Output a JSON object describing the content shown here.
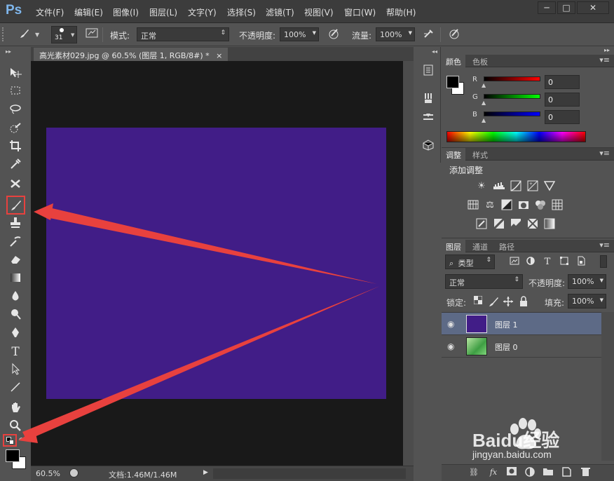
{
  "app": {
    "logo": "Ps"
  },
  "menu": [
    "文件(F)",
    "编辑(E)",
    "图像(I)",
    "图层(L)",
    "文字(Y)",
    "选择(S)",
    "滤镜(T)",
    "视图(V)",
    "窗口(W)",
    "帮助(H)"
  ],
  "window_buttons": {
    "minimize": "─",
    "maximize": "□",
    "close": "✕"
  },
  "options": {
    "brush_size": "31",
    "mode_label": "模式:",
    "mode_value": "正常",
    "opacity_label": "不透明度:",
    "opacity_value": "100%",
    "flow_label": "流量:",
    "flow_value": "100%"
  },
  "document": {
    "tab_title": "高光素材029.jpg @ 60.5% (图层 1, RGB/8#) *",
    "close": "×",
    "canvas_color": "#411d87"
  },
  "status": {
    "zoom": "60.5%",
    "doc_info": "文档:1.46M/1.46M"
  },
  "color_panel": {
    "tabs": [
      "颜色",
      "色板"
    ],
    "channels": [
      {
        "label": "R",
        "value": "0"
      },
      {
        "label": "G",
        "value": "0"
      },
      {
        "label": "B",
        "value": "0"
      }
    ]
  },
  "adjust_panel": {
    "tabs": [
      "调整",
      "样式"
    ],
    "heading": "添加调整"
  },
  "layers_panel": {
    "tabs": [
      "图层",
      "通道",
      "路径"
    ],
    "filter_label": "类型",
    "blend_mode": "正常",
    "opacity_label": "不透明度:",
    "opacity_value": "100%",
    "lock_label": "锁定:",
    "fill_label": "填充:",
    "fill_value": "100%",
    "layers": [
      {
        "name": "图层 1",
        "selected": true
      },
      {
        "name": "图层 0",
        "selected": false
      }
    ]
  },
  "watermark": {
    "brand": "Baidu经验",
    "url": "jingyan.baidu.com"
  },
  "colors": {
    "canvas": "#411d87",
    "arrow": "#e8413e",
    "highlight_box": "#e8413e",
    "selected_layer_bg": "#5d6a86"
  }
}
